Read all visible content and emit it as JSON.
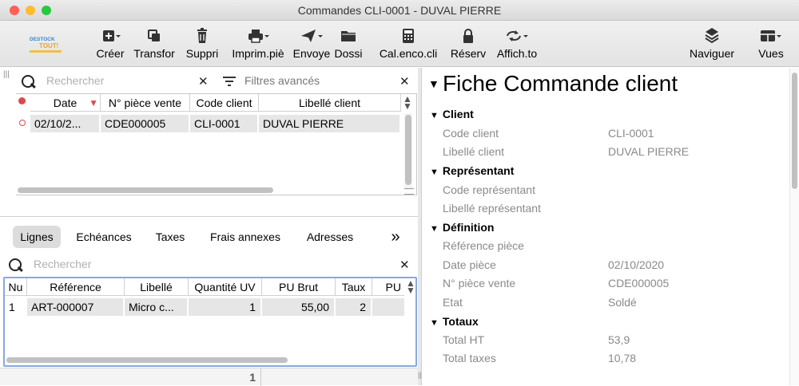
{
  "window": {
    "title": "Commandes CLI-0001 - DUVAL PIERRE"
  },
  "toolbar": {
    "logo_text": "DESTOCK TOUT!",
    "buttons": [
      {
        "label": "Créer",
        "icon": "create-icon"
      },
      {
        "label": "Transfor",
        "icon": "transform-icon"
      },
      {
        "label": "Suppri",
        "icon": "trash-icon"
      },
      {
        "label": "Imprim.piè",
        "icon": "printer-icon"
      },
      {
        "label": "Envoye",
        "icon": "send-icon"
      },
      {
        "label": "Dossi",
        "icon": "folder-icon"
      },
      {
        "label": "Cal.enco.cli",
        "icon": "calculator-icon"
      },
      {
        "label": "Réserv",
        "icon": "lock-icon"
      },
      {
        "label": "Affich.to",
        "icon": "refresh-icon"
      },
      {
        "label": "Naviguer",
        "icon": "layers-icon"
      },
      {
        "label": "Vues",
        "icon": "views-icon"
      }
    ]
  },
  "top_list": {
    "search_placeholder": "Rechercher",
    "filters_label": "Filtres avancés",
    "columns": [
      "Date",
      "N° pièce vente",
      "Code client",
      "Libellé client"
    ],
    "rows": [
      [
        "02/10/2...",
        "CDE000005",
        "CLI-0001",
        "DUVAL PIERRE"
      ]
    ]
  },
  "tabs": [
    "Lignes",
    "Echéances",
    "Taxes",
    "Frais annexes",
    "Adresses"
  ],
  "tabs_more": "»",
  "lines": {
    "search_placeholder": "Rechercher",
    "columns": [
      "Nu",
      "Référence",
      "Libellé",
      "Quantité UV",
      "PU Brut",
      "Taux",
      "PU"
    ],
    "rows": [
      [
        "1",
        "ART-000007",
        "Micro c...",
        "1",
        "55,00",
        "2",
        ""
      ]
    ],
    "footer_count": "1"
  },
  "detail": {
    "title": "Fiche Commande client",
    "sections": [
      {
        "title": "Client",
        "fields": [
          [
            "Code client",
            "CLI-0001"
          ],
          [
            "Libellé client",
            "DUVAL PIERRE"
          ]
        ]
      },
      {
        "title": "Représentant",
        "fields": [
          [
            "Code représentant",
            ""
          ],
          [
            "Libellé représentant",
            ""
          ]
        ]
      },
      {
        "title": "Définition",
        "fields": [
          [
            "Référence pièce",
            ""
          ],
          [
            "Date pièce",
            "02/10/2020"
          ],
          [
            "N° pièce vente",
            "CDE000005"
          ],
          [
            "Etat",
            "Soldé"
          ]
        ]
      },
      {
        "title": "Totaux",
        "fields": [
          [
            "Total HT",
            "53,9"
          ],
          [
            "Total taxes",
            "10,78"
          ]
        ]
      }
    ]
  },
  "colors": {
    "accent_red": "#e0484f",
    "selection_border": "#86a9e0",
    "row_bg": "#e6e6e6"
  }
}
